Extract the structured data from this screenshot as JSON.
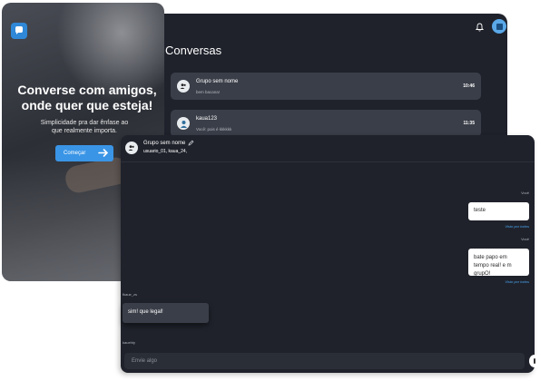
{
  "hero": {
    "title": "Converse com amigos, onde quer que esteja!",
    "subtitle": "Simplicidade pra dar ênfase ao que realmente importa.",
    "button_label": "Começar",
    "logo_icon": "chat-logo-icon",
    "accent": "#3a95e6"
  },
  "conversations": {
    "title": "Conversas",
    "items": [
      {
        "name": "Grupo sem nome",
        "last_message": "bem bacana!",
        "time": "10:46"
      },
      {
        "name": "kaua123",
        "last_message": "Você: pois é kkkkkk",
        "time": "11:35"
      }
    ]
  },
  "chat": {
    "group_name": "Grupo sem nome",
    "members": "usuario_01, kaua_24,",
    "messages": [
      {
        "sender": "Você",
        "text": "teste",
        "direction": "out",
        "seen": "Visto por todos"
      },
      {
        "sender": "Você",
        "text": "bate papo em tempo real! e m grupO!",
        "direction": "out",
        "seen": "Visto por todos"
      },
      {
        "sender": "fkaue_zs",
        "text": "sim! que legal!",
        "direction": "in"
      },
      {
        "sender": "kauehty",
        "text": "",
        "direction": "in"
      }
    ],
    "input_placeholder": "Envie algo"
  },
  "colors": {
    "window_bg": "#1f222b",
    "item_bg": "#3a3e48",
    "seen_text": "#4aa3ee"
  }
}
